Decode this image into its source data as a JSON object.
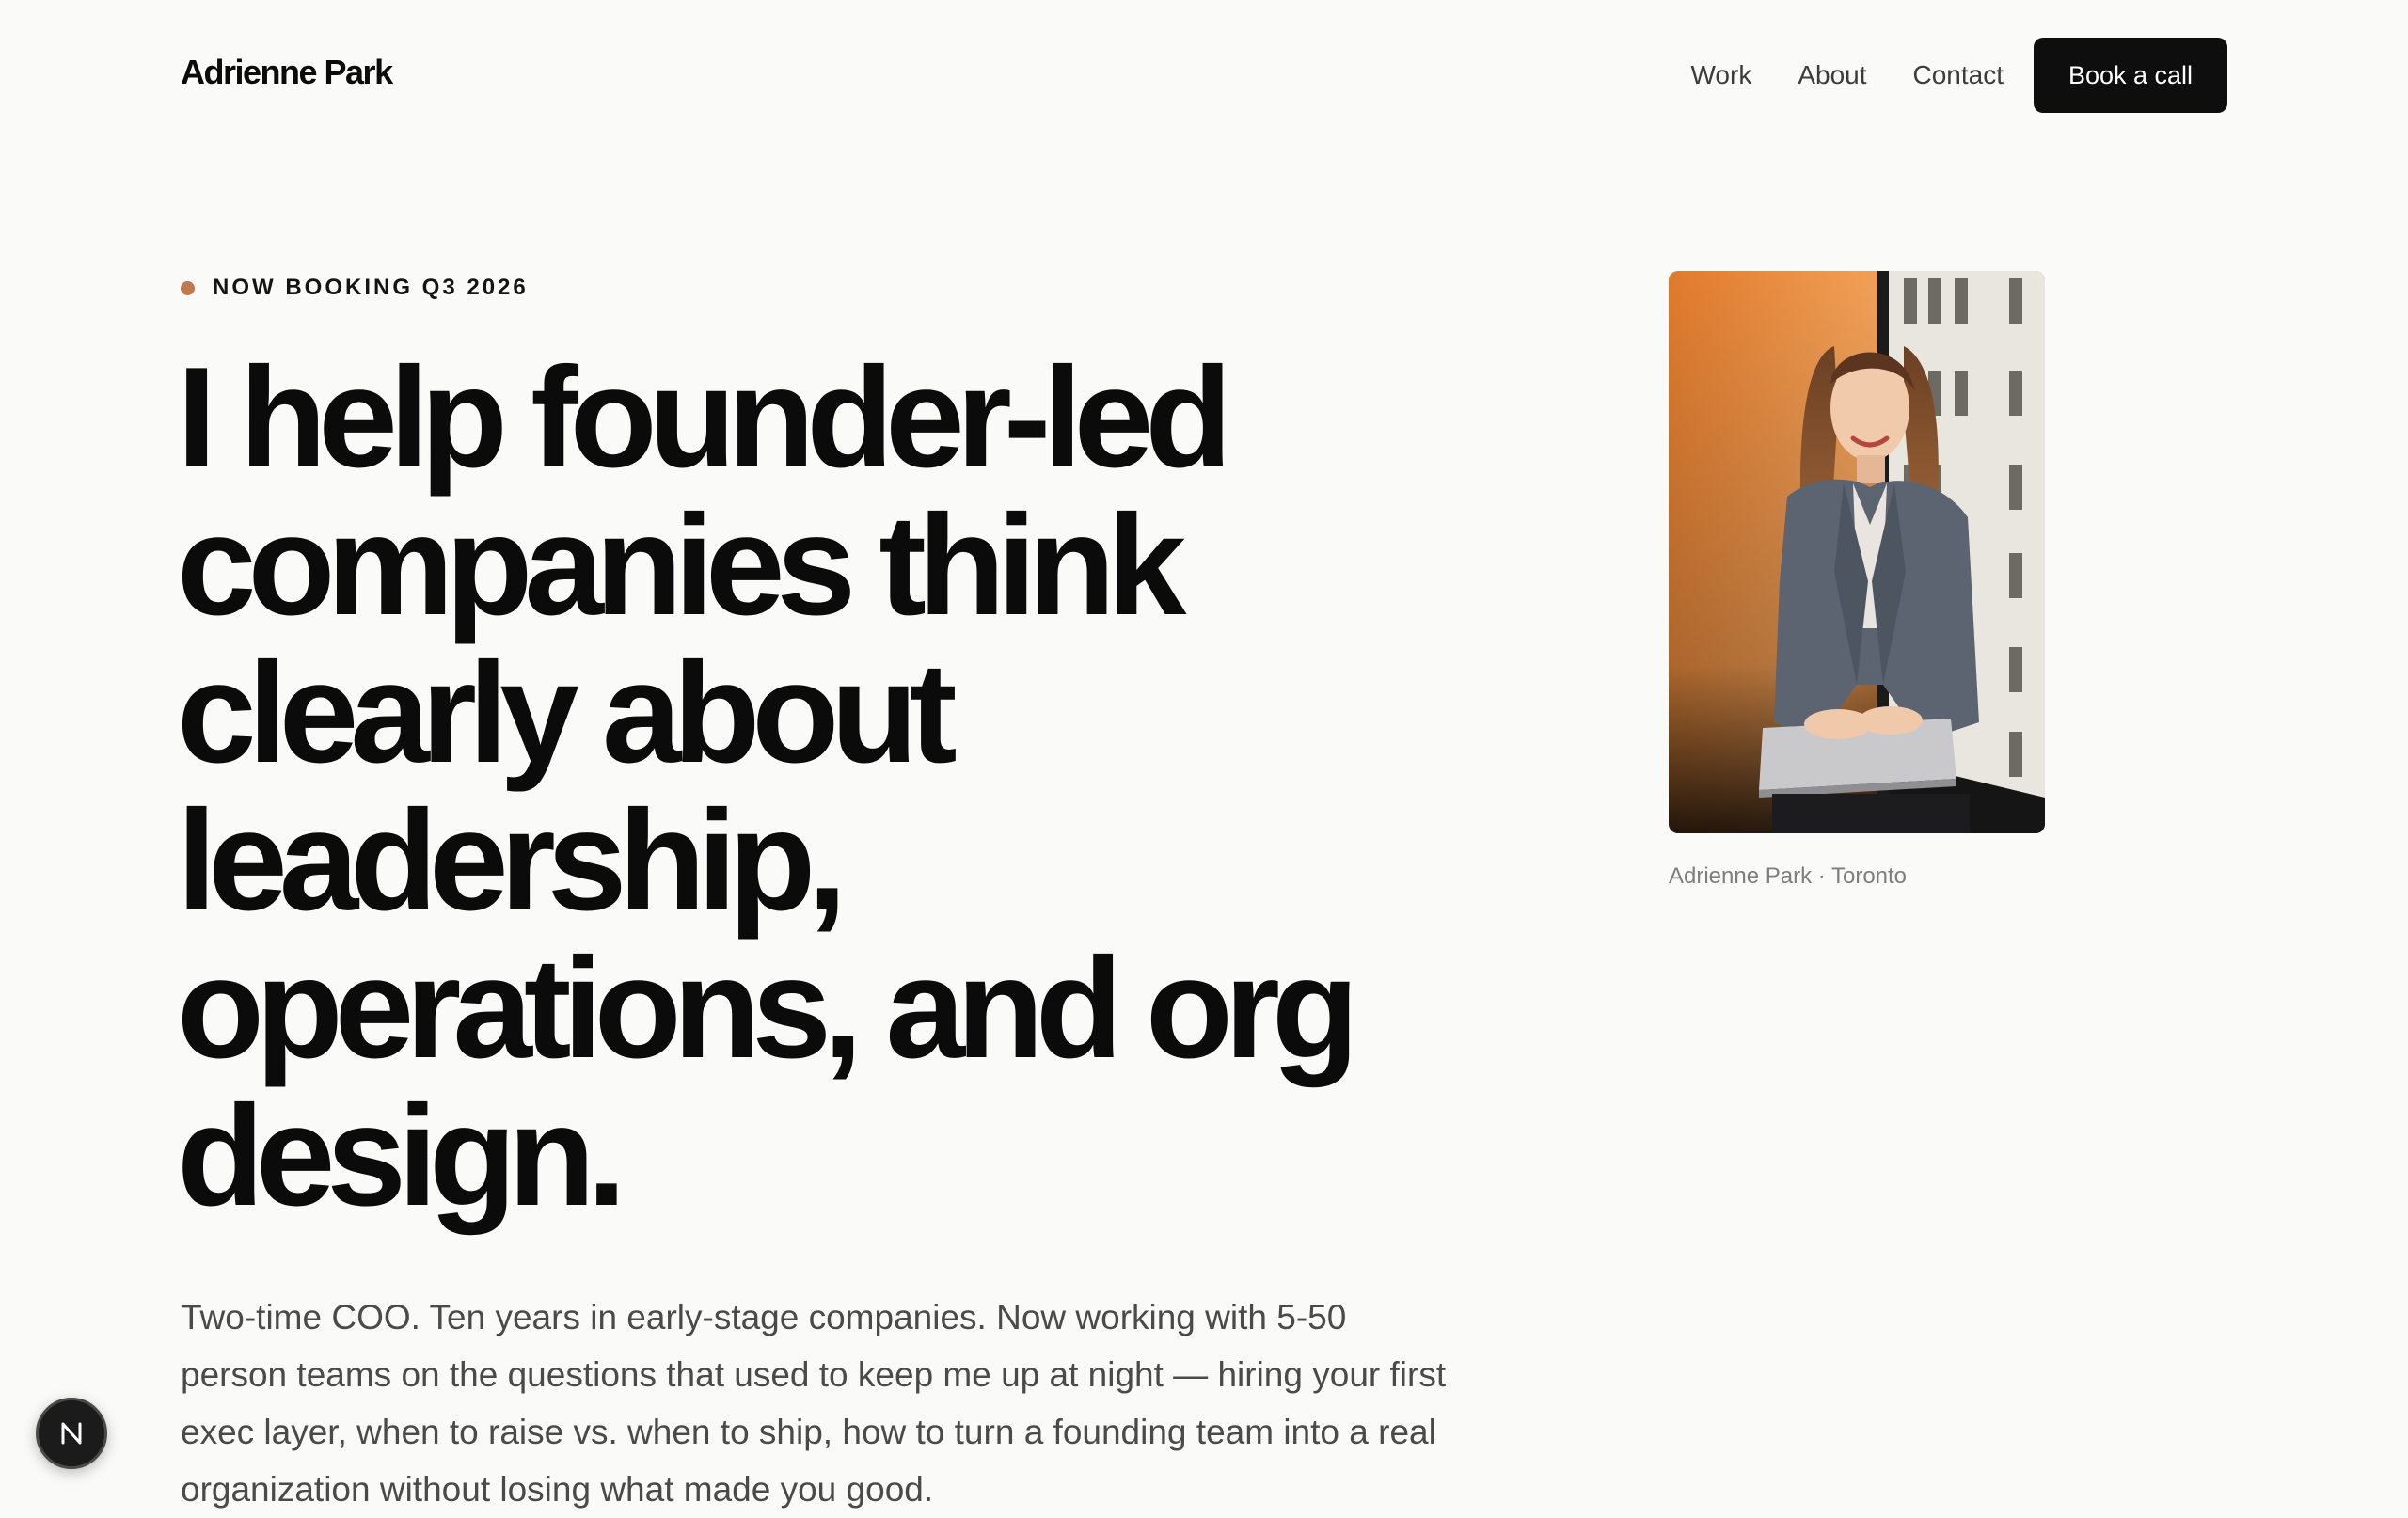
{
  "header": {
    "brand": "Adrienne Park",
    "nav": [
      "Work",
      "About",
      "Contact"
    ],
    "cta": "Book a call"
  },
  "hero": {
    "eyebrow": "NOW BOOKING Q3 2026",
    "headline_lines": [
      "I help founder-led",
      "companies think",
      "clearly about",
      "leadership,",
      "operations, and org",
      "design."
    ],
    "intro": "Two-time COO. Ten years in early-stage companies. Now working with 5-50 person teams on the questions that used to keep me up at night — hiring your first exec layer, when to raise vs. when to ship, how to turn a founding team into a real organization without losing what made you good."
  },
  "portrait": {
    "caption": "Adrienne Park · Toronto"
  },
  "colors": {
    "background": "#fafaf8",
    "ink": "#0b0b0b",
    "accent_dot": "#c0784f",
    "button": "#0e0e0e"
  },
  "badge": {
    "icon": "n-logo-icon"
  }
}
